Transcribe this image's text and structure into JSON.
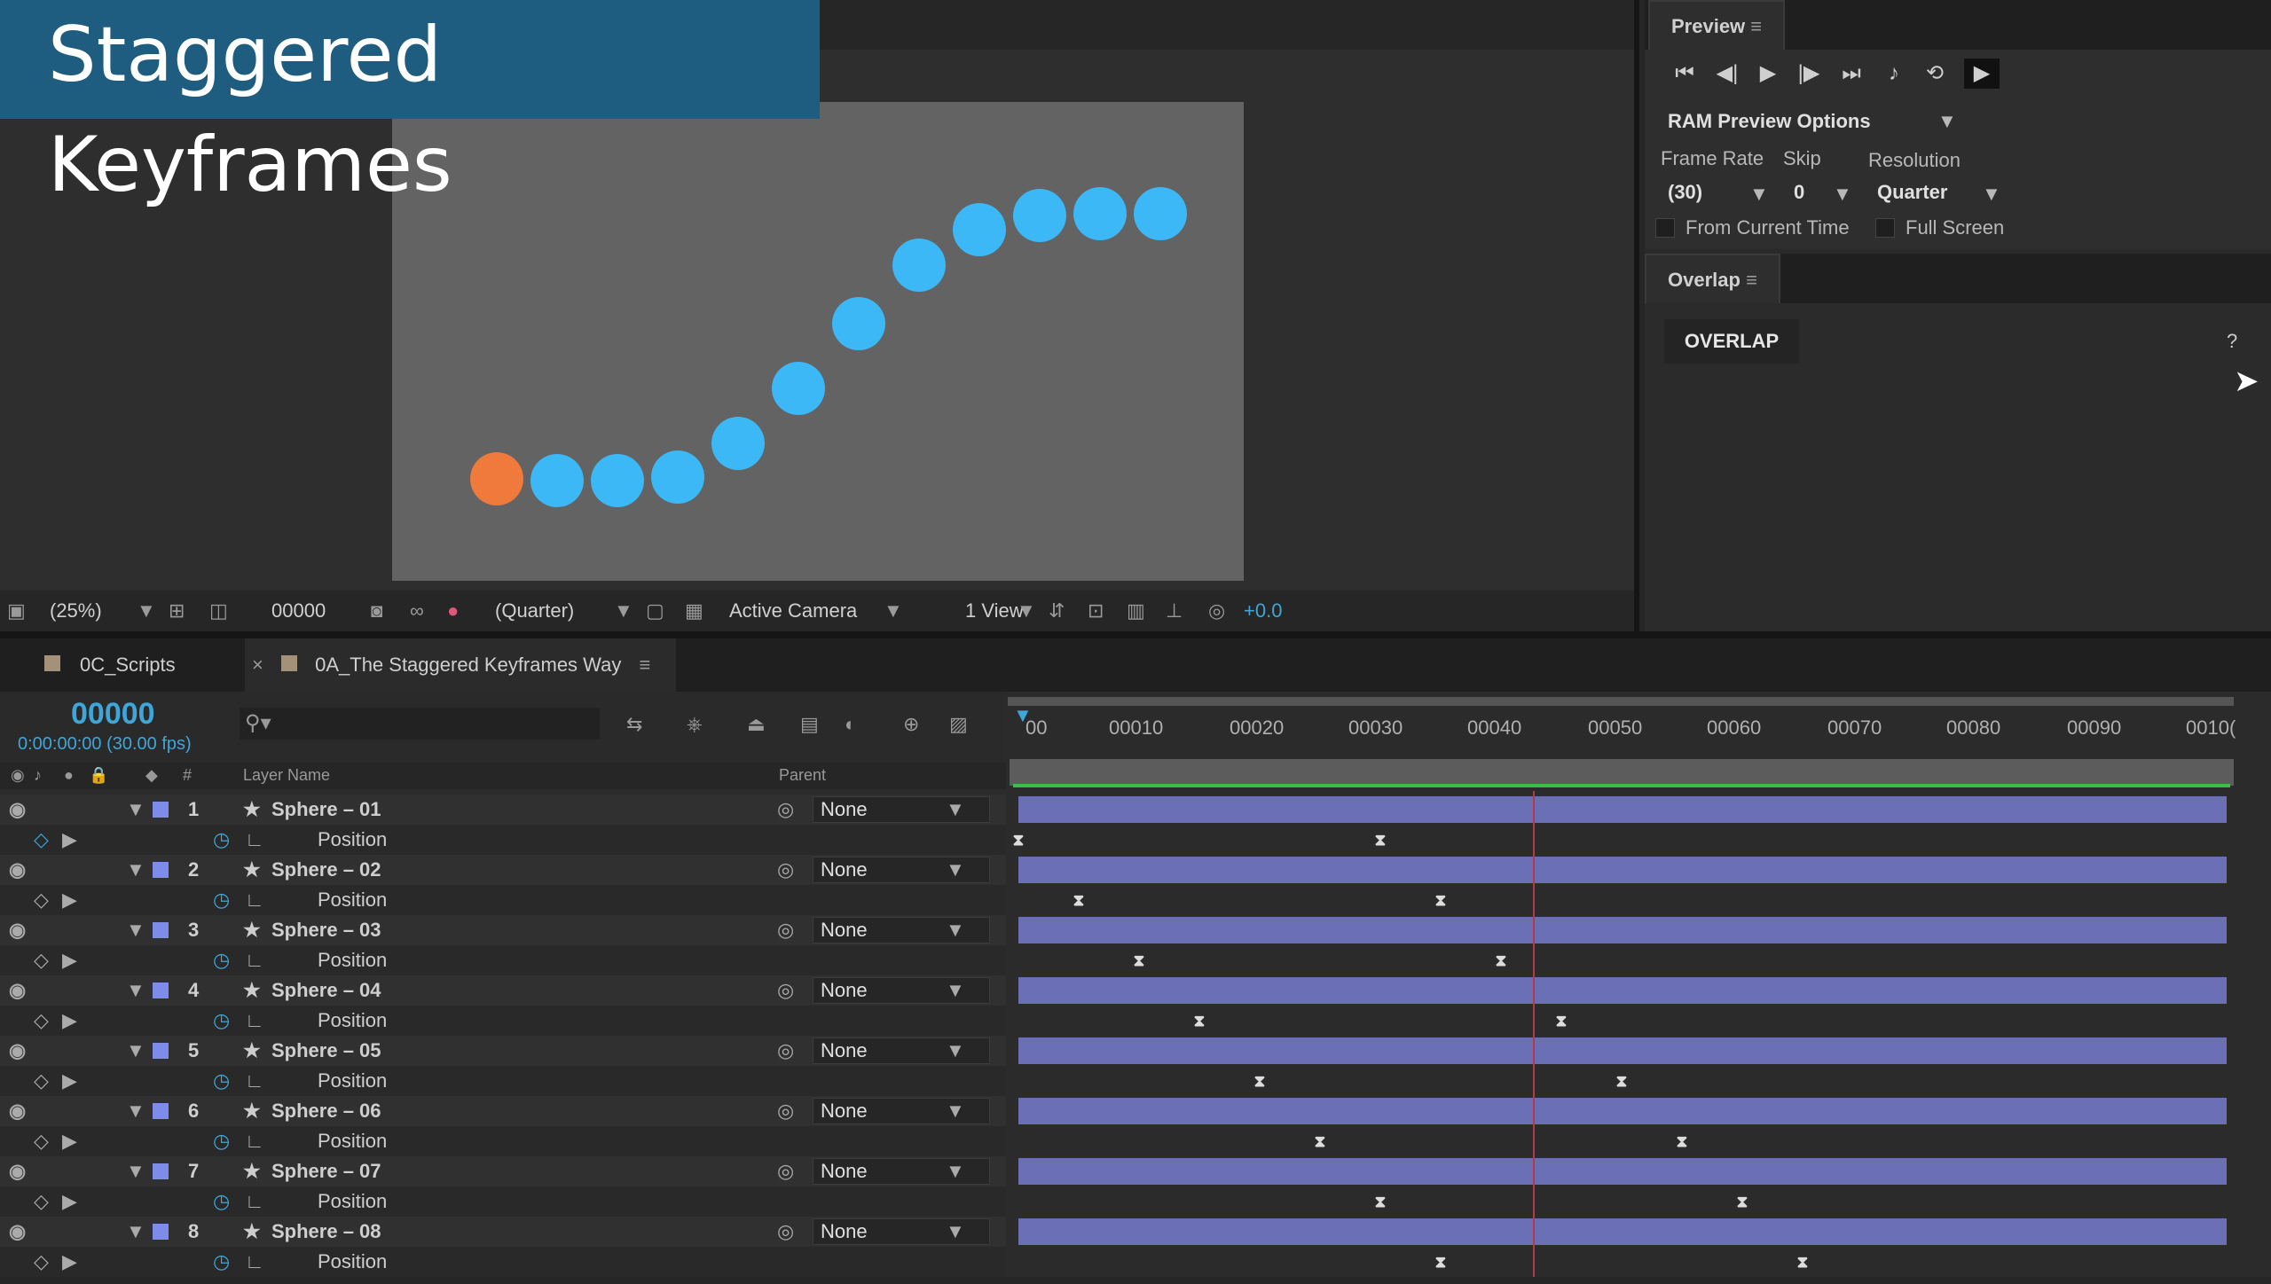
{
  "title": "Staggered Keyframes",
  "viewer": {
    "zoom": "(25%)",
    "timecode": "00000",
    "resolution": "(Quarter)",
    "camera": "Active Camera",
    "views": "1 View",
    "exposure": "+0.0"
  },
  "preview": {
    "tab": "Preview",
    "options_label": "RAM Preview Options",
    "frame_rate_label": "Frame Rate",
    "skip_label": "Skip",
    "resolution_label": "Resolution",
    "frame_rate": "(30)",
    "skip": "0",
    "resolution": "Quarter",
    "from_current_time": "From Current Time",
    "full_screen": "Full Screen"
  },
  "overlap": {
    "tab": "Overlap",
    "button": "OVERLAP",
    "help": "?"
  },
  "timeline": {
    "tab1": "0C_Scripts",
    "tab2": "0A_The Staggered Keyframes Way",
    "time": "00000",
    "time_sub": "0:00:00:00 (30.00 fps)",
    "col_num": "#",
    "col_layer": "Layer Name",
    "col_parent": "Parent",
    "ticks": [
      "00",
      "00010",
      "00020",
      "00030",
      "00040",
      "00050",
      "00060",
      "00070",
      "00080",
      "00090",
      "0010("
    ],
    "layers": [
      {
        "num": "1",
        "name": "Sphere – 01",
        "parent": "None",
        "prop": "Position",
        "kf": [
          0,
          30
        ]
      },
      {
        "num": "2",
        "name": "Sphere – 02",
        "parent": "None",
        "prop": "Position",
        "kf": [
          5,
          35
        ]
      },
      {
        "num": "3",
        "name": "Sphere – 03",
        "parent": "None",
        "prop": "Position",
        "kf": [
          10,
          40
        ]
      },
      {
        "num": "4",
        "name": "Sphere – 04",
        "parent": "None",
        "prop": "Position",
        "kf": [
          15,
          45
        ]
      },
      {
        "num": "5",
        "name": "Sphere – 05",
        "parent": "None",
        "prop": "Position",
        "kf": [
          20,
          50
        ]
      },
      {
        "num": "6",
        "name": "Sphere – 06",
        "parent": "None",
        "prop": "Position",
        "kf": [
          25,
          55
        ]
      },
      {
        "num": "7",
        "name": "Sphere – 07",
        "parent": "None",
        "prop": "Position",
        "kf": [
          30,
          60
        ]
      },
      {
        "num": "8",
        "name": "Sphere – 08",
        "parent": "None",
        "prop": "Position",
        "kf": [
          35,
          65
        ]
      }
    ]
  }
}
